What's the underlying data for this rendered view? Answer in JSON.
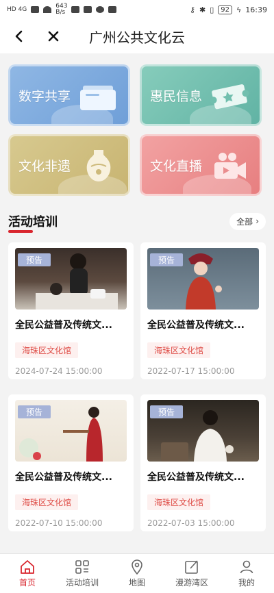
{
  "status": {
    "network": "HD 4G",
    "speed": "643",
    "speed_unit": "B/s",
    "battery": "92",
    "time": "16:39"
  },
  "header": {
    "title": "广州公共文化云"
  },
  "tiles": [
    {
      "label": "数字共享",
      "icon": "folder-icon"
    },
    {
      "label": "惠民信息",
      "icon": "ticket-icon"
    },
    {
      "label": "文化非遗",
      "icon": "vase-icon"
    },
    {
      "label": "文化直播",
      "icon": "video-camera-icon"
    }
  ],
  "section": {
    "title": "活动培训",
    "more": "全部"
  },
  "cards": [
    {
      "badge": "预告",
      "title": "全民公益普及传统文...",
      "venue": "海珠区文化馆",
      "date": "2024-07-24 15:00:00"
    },
    {
      "badge": "预告",
      "title": "全民公益普及传统文...",
      "venue": "海珠区文化馆",
      "date": "2022-07-17 15:00:00"
    },
    {
      "badge": "预告",
      "title": "全民公益普及传统文...",
      "venue": "海珠区文化馆",
      "date": "2022-07-10 15:00:00"
    },
    {
      "badge": "预告",
      "title": "全民公益普及传统文...",
      "venue": "海珠区文化馆",
      "date": "2022-07-03 15:00:00"
    }
  ],
  "tabbar": [
    {
      "label": "首页",
      "icon": "home-icon"
    },
    {
      "label": "活动培训",
      "icon": "grid-icon"
    },
    {
      "label": "地图",
      "icon": "location-pin-icon"
    },
    {
      "label": "漫游湾区",
      "icon": "edit-icon"
    },
    {
      "label": "我的",
      "icon": "user-icon"
    }
  ],
  "colors": {
    "accent": "#d9262e",
    "badge": "#a6b3d8",
    "venue_bg": "#fdf0ef",
    "venue_text": "#de4b45"
  }
}
